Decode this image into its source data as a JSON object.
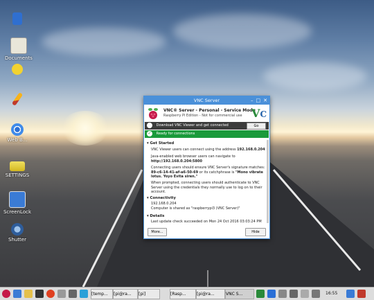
{
  "desktop": {
    "icons": [
      {
        "name": "trash-icon",
        "label": ""
      },
      {
        "name": "documents-icon",
        "label": "Documents"
      },
      {
        "name": "smiley-icon",
        "label": ""
      },
      {
        "name": "pencil-icon",
        "label": ""
      },
      {
        "name": "chromium-icon",
        "label": "Web B..."
      },
      {
        "name": "settings-icon",
        "label": "SETTINGS"
      },
      {
        "name": "screenlock-icon",
        "label": "ScreenLock"
      },
      {
        "name": "shutter-icon",
        "label": "Shutter"
      }
    ]
  },
  "vnc": {
    "window_title": "VNC Server",
    "header_title": "VNC® Server - Personal - Service Mode",
    "header_sub": "Raspberry Pi Edition - Not for commercial use",
    "download_text": "Download VNC Viewer and get connected",
    "go_label": "Go",
    "ready_text": "Ready for connections",
    "get_started": "Get Started",
    "gs_p1_a": "VNC Viewer users can connect using the address ",
    "gs_p1_b": "192.168.0.204",
    "gs_p2_a": "Java-enabled web browser users can navigate to",
    "gs_p2_b": "http://192.168.0.204:5800",
    "gs_p3": "Connecting users should ensure VNC Server's signature matches:",
    "gs_p3_sig": "89-c6-14-41-af-a6-50-69",
    "gs_p3_c": " or its catchphrase is ",
    "gs_p3_phrase": "\"Mono vibrate lotus. Yoyo Evita siren.\"",
    "gs_p4": "When prompted, connecting users should authenticate to VNC Server using the credentials they normally use to log on to their account.",
    "connectivity": "Connectivity",
    "conn_ip": "192.168.0.204",
    "conn_shared": "Computer is shared as \"raspberrypi3 (VNC Server)\"",
    "details": "Details",
    "details_text": "Last update check succeeded on Mon 24 Oct 2016 03:03:24 PM",
    "more_label": "More...",
    "hide_label": "Hide"
  },
  "taskbar": {
    "windows": [
      "[temp...",
      "[pi@ra...",
      "[pi]",
      "[Rasp...",
      "[pi@ra...",
      "VNC S..."
    ],
    "clock": "16:55"
  },
  "colors": {
    "vnc_accent": "#4a90d9",
    "ready_green": "#1a9a3b"
  }
}
